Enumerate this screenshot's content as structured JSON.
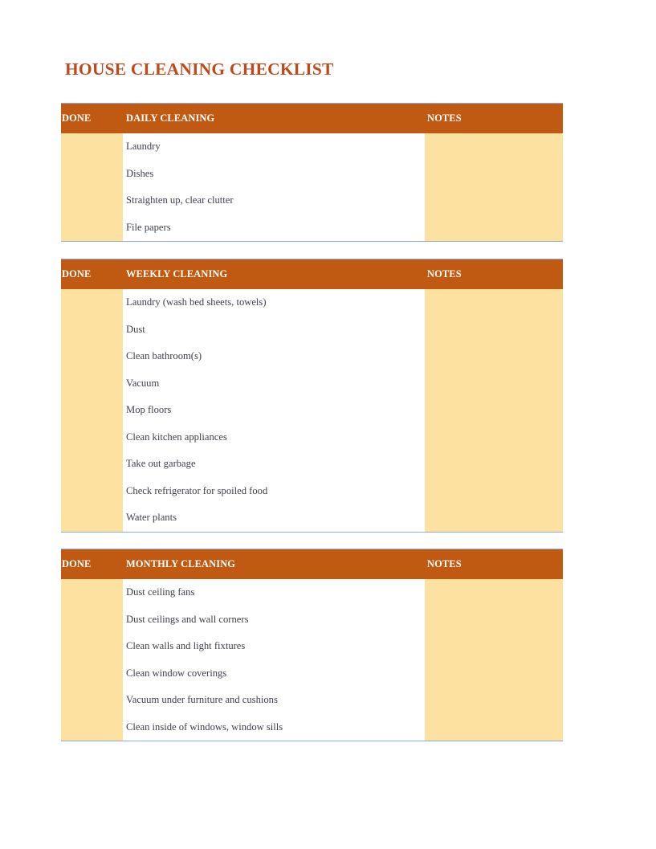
{
  "document": {
    "title": "HOUSE CLEANING CHECKLIST"
  },
  "colors": {
    "title_text": "#C0491A",
    "header_background": "#C05A12",
    "header_text": "#FFFFFF",
    "fill_yellow": "#FCE1A0",
    "body_text": "#3E3E4E",
    "table_border": "#8FAADC"
  },
  "columns": {
    "done": "DONE",
    "notes": "NOTES"
  },
  "sections": [
    {
      "id": "daily",
      "header": {
        "done": "DONE",
        "title": "DAILY CLEANING",
        "notes": "NOTES"
      },
      "items": [
        "Laundry",
        "Dishes",
        "Straighten up, clear clutter",
        "File papers"
      ]
    },
    {
      "id": "weekly",
      "header": {
        "done": "DONE",
        "title": "WEEKLY CLEANING",
        "notes": "NOTES"
      },
      "items": [
        "Laundry (wash bed sheets, towels)",
        "Dust",
        "Clean bathroom(s)",
        "Vacuum",
        "Mop floors",
        "Clean kitchen appliances",
        "Take out garbage",
        "Check refrigerator for spoiled food",
        "Water plants"
      ]
    },
    {
      "id": "monthly",
      "header": {
        "done": "DONE",
        "title": "MONTHLY CLEANING",
        "notes": "NOTES"
      },
      "items": [
        "Dust ceiling fans",
        "Dust ceilings and wall corners",
        "Clean walls and light fixtures",
        "Clean window coverings",
        "Vacuum under furniture and cushions",
        "Clean inside of windows, window sills"
      ]
    }
  ]
}
